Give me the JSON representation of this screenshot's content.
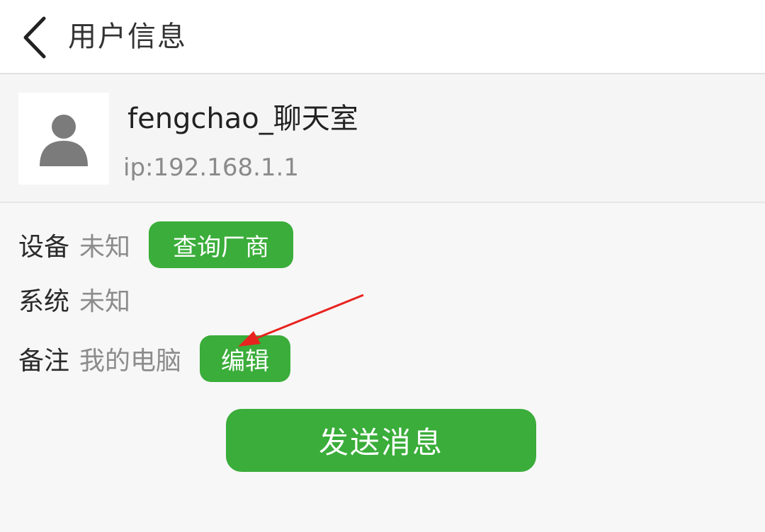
{
  "header": {
    "title": "用户信息",
    "back_icon": "chevron-left-icon"
  },
  "profile": {
    "avatar_icon": "user-avatar-icon",
    "name": "fengchao_聊天室",
    "ip": "ip:192.168.1.1"
  },
  "info": {
    "device": {
      "label": "设备",
      "value": "未知",
      "button": "查询厂商"
    },
    "system": {
      "label": "系统",
      "value": "未知"
    },
    "remark": {
      "label": "备注",
      "value": "我的电脑",
      "button": "编辑"
    }
  },
  "actions": {
    "send_label": "发送消息"
  },
  "colors": {
    "accent": "#3aad3a",
    "annotation_arrow": "#e8231f"
  }
}
